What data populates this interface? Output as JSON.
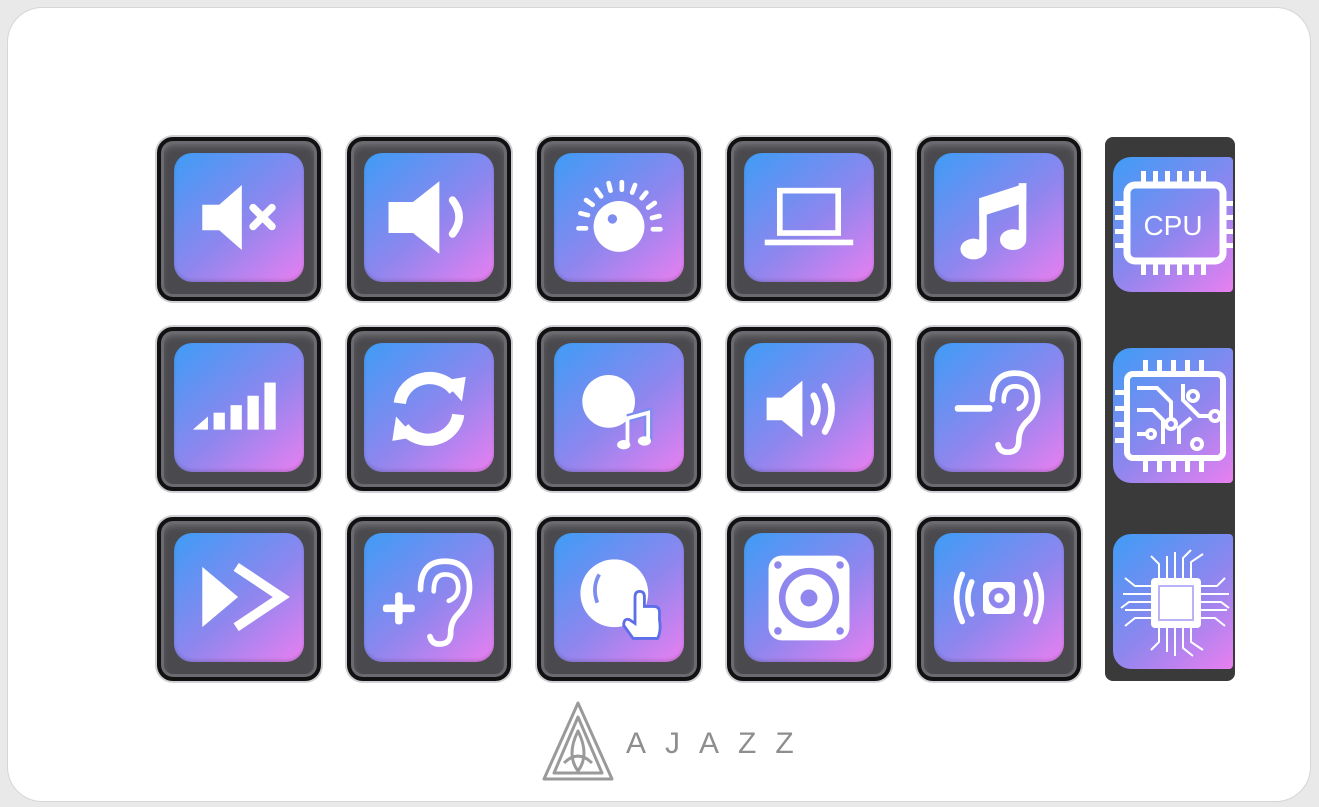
{
  "device": {
    "brand_text": "AJAZZ",
    "accent_colors": {
      "gradient_start": "#3e9cf6",
      "gradient_mid": "#8f86ee",
      "gradient_end": "#e97ff0",
      "key_frame": "#4a4a4e",
      "strip": "#3a3a3a"
    },
    "keys": [
      {
        "icon": "volume-mute-icon"
      },
      {
        "icon": "volume-low-icon"
      },
      {
        "icon": "volume-knob-icon"
      },
      {
        "icon": "laptop-icon"
      },
      {
        "icon": "music-note-icon"
      },
      {
        "icon": "signal-bars-icon"
      },
      {
        "icon": "refresh-icon"
      },
      {
        "icon": "knob-music-icon"
      },
      {
        "icon": "volume-high-icon"
      },
      {
        "icon": "hearing-decrease-icon"
      },
      {
        "icon": "fast-forward-icon"
      },
      {
        "icon": "hearing-increase-icon"
      },
      {
        "icon": "knob-touch-icon"
      },
      {
        "icon": "speaker-icon"
      },
      {
        "icon": "speaker-vibrate-icon"
      }
    ],
    "side_screen": [
      {
        "icon": "cpu-chip-icon",
        "label": "CPU"
      },
      {
        "icon": "circuit-chip-icon"
      },
      {
        "icon": "processor-board-icon"
      }
    ]
  }
}
